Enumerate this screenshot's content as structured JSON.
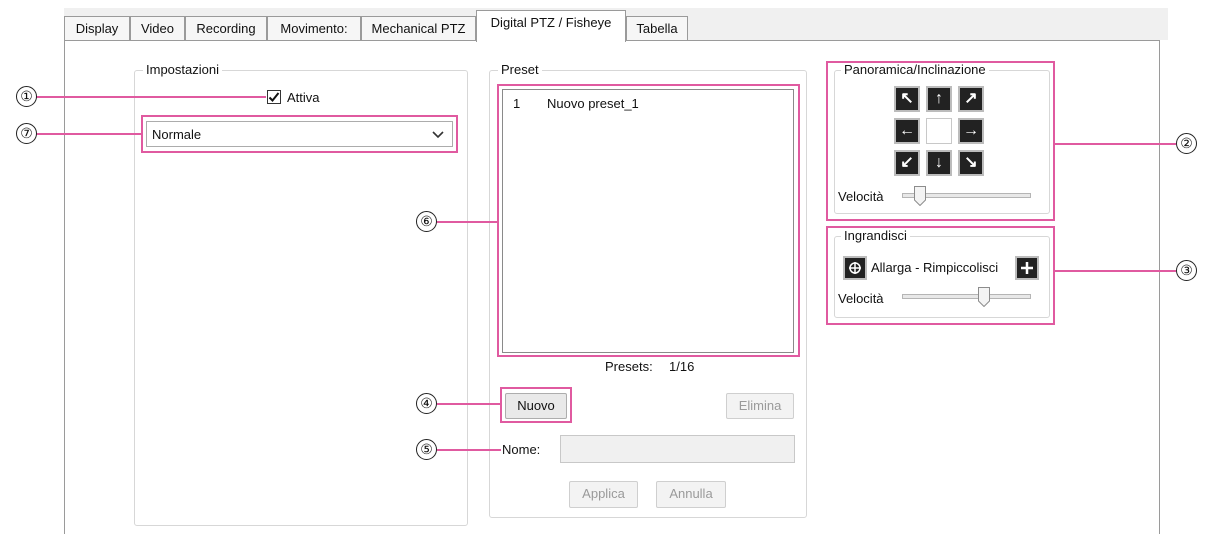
{
  "tabs": [
    "Display",
    "Video",
    "Recording",
    "Movimento:",
    "Mechanical PTZ",
    "Digital PTZ / Fisheye",
    "Tabella"
  ],
  "active_tab": "Digital PTZ / Fisheye",
  "settings": {
    "legend": "Impostazioni",
    "enable_label": "Attiva",
    "enable_checked": true,
    "mode_value": "Normale"
  },
  "preset": {
    "legend": "Preset",
    "list": [
      {
        "num": "1",
        "name": "Nuovo preset_1"
      }
    ],
    "count_label": "Presets:",
    "count_value": "1/16",
    "new_button": "Nuovo",
    "delete_button": "Elimina",
    "name_label": "Nome:",
    "name_value": "",
    "apply_button": "Applica",
    "cancel_button": "Annulla"
  },
  "pan_tilt": {
    "legend": "Panoramica/Inclinazione",
    "speed_label": "Velocità",
    "speed_value": 0.1,
    "arrows": [
      "arrow-up-left-icon",
      "arrow-up-icon",
      "arrow-up-right-icon",
      "arrow-left-icon",
      "center",
      "arrow-right-icon",
      "arrow-down-left-icon",
      "arrow-down-icon",
      "arrow-down-right-icon"
    ]
  },
  "zoom": {
    "legend": "Ingrandisci",
    "zoom_label": "Allarga - Rimpiccolisci",
    "speed_label": "Velocità",
    "speed_value": 0.65,
    "zoom_out_icon": "zoom-out-icon",
    "zoom_in_icon": "plus-icon"
  },
  "callouts": [
    "①",
    "②",
    "③",
    "④",
    "⑤",
    "⑥",
    "⑦"
  ],
  "colors": {
    "highlight": "#e05aa0"
  }
}
